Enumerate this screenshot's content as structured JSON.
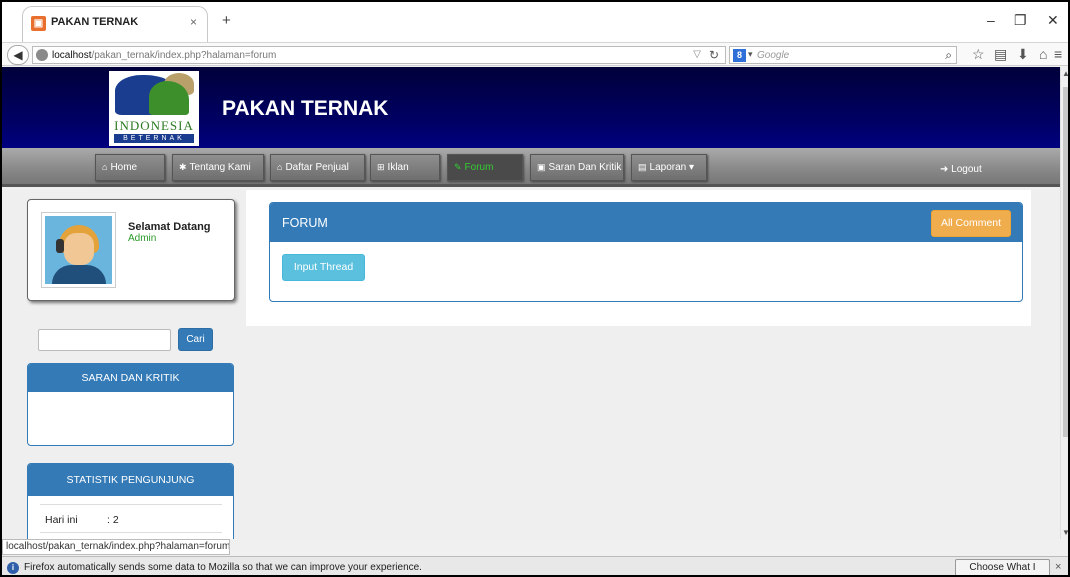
{
  "browser": {
    "tab_title": "PAKAN TERNAK",
    "new_tab": "+",
    "url_host": "localhost",
    "url_path": "/pakan_ternak/index.php?halaman=forum",
    "search_placeholder": "Google",
    "status_url": "localhost/pakan_ternak/index.php?halaman=forum"
  },
  "site": {
    "title": "PAKAN TERNAK",
    "logo_text": "INDONESIA",
    "logo_subtext": "BETERNAK"
  },
  "menu": {
    "items": [
      {
        "label": "Home",
        "icon": "home-icon",
        "glyph": "⌂"
      },
      {
        "label": "Tentang Kami",
        "icon": "asterisk-icon",
        "glyph": "✱"
      },
      {
        "label": "Daftar Penjual",
        "icon": "home-icon",
        "glyph": "⌂"
      },
      {
        "label": "Iklan",
        "icon": "shopping-cart-icon",
        "glyph": "🛒"
      },
      {
        "label": "Forum",
        "icon": "comment-icon",
        "glyph": "✎",
        "active": true
      },
      {
        "label": "Saran Dan Kritik",
        "icon": "book-icon",
        "glyph": "▣"
      },
      {
        "label": "Laporan",
        "icon": "list-icon",
        "glyph": "▤"
      }
    ],
    "logout": "Logout"
  },
  "sidebar": {
    "welcome": "Selamat Datang",
    "role": "Admin",
    "search_button": "Cari",
    "saran_title": "SARAN DAN KRITIK",
    "stats_title": "STATISTIK PENGUNJUNG",
    "stats": [
      {
        "label": "Hari ini",
        "value": ": 2"
      }
    ]
  },
  "main": {
    "panel_title": "FORUM",
    "all_comment": "All Comment",
    "input_thread": "Input Thread"
  },
  "notification": {
    "message": "Firefox automatically sends some data to Mozilla so that we can improve your experience.",
    "button": "Choose What I Share",
    "close": "×"
  },
  "colors": {
    "primary": "#337ab7",
    "warning": "#f0ad4e",
    "info": "#5bc0de",
    "banner": "#000066"
  }
}
